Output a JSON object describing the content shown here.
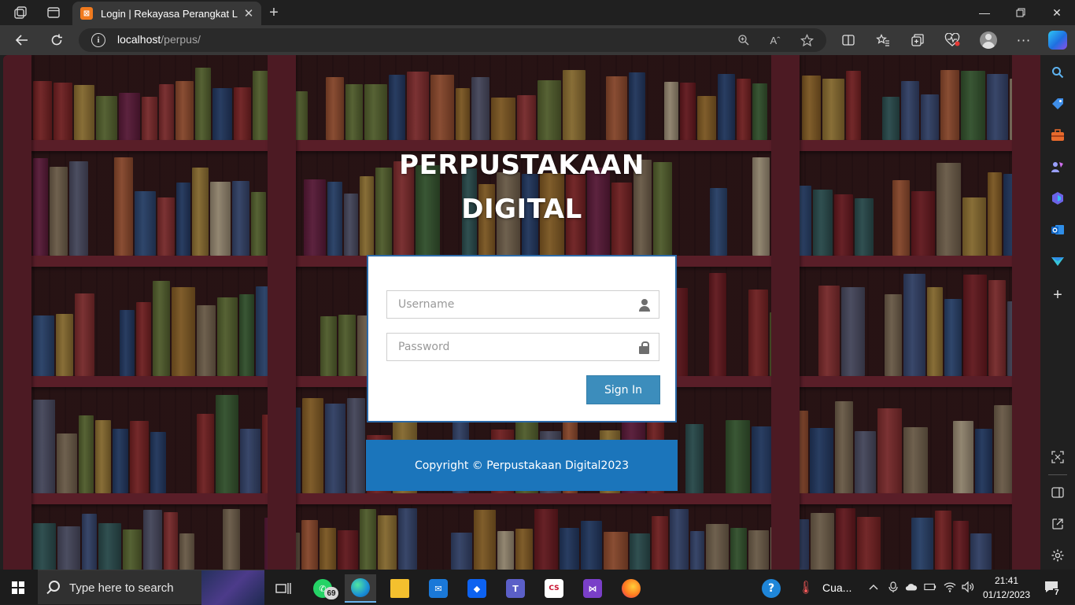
{
  "browser": {
    "tab_title": "Login | Rekayasa Perangkat Lunak",
    "tab_favicon_text": "⊠",
    "url_host": "localhost",
    "url_path": "/perpus/",
    "accent": "#f07a1e"
  },
  "page": {
    "title_line1": "PERPUSTAKAAN",
    "title_line2": "DIGITAL",
    "username_placeholder": "Username",
    "password_placeholder": "Password",
    "signin_label": "Sign In",
    "footer_text": "Copyright © Perpustakaan Digital2023",
    "colors": {
      "login_border": "#2c6aa8",
      "signin_button": "#3c8dbc",
      "footer_bar": "#1b75bb",
      "shelf": "#6f2430"
    }
  },
  "sidebar_icons": [
    "search-icon",
    "shopping-tag-icon",
    "tools-icon",
    "games-icon",
    "microsoft-365-icon",
    "outlook-icon",
    "drop-icon",
    "add-icon",
    "screenshot-icon",
    "hide-sidebar-icon",
    "open-external-icon",
    "settings-icon"
  ],
  "taskbar": {
    "search_placeholder": "Type here to search",
    "whatsapp_badge": "69",
    "weather_text": "Cua...",
    "time": "21:41",
    "date": "01/12/2023",
    "notification_count": "7"
  }
}
